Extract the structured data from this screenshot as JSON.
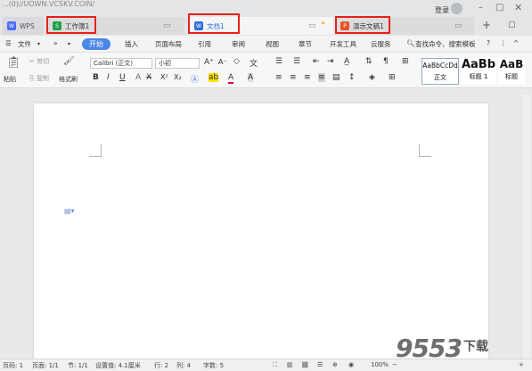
{
  "watermark_top": "...(0)//UOWN.VCSKV.COIN/",
  "titlebar": {
    "login": "登录",
    "tabs": [
      {
        "label": "WPS"
      },
      {
        "label": "工作簿1"
      },
      {
        "label": "文档1"
      },
      {
        "label": "演示文稿1"
      }
    ],
    "new_tab": "+",
    "menu_icon": "☰"
  },
  "menubar": {
    "file": "文件",
    "more": "»",
    "items": [
      "开始",
      "插入",
      "页面布局",
      "引用",
      "审阅",
      "视图",
      "章节",
      "开发工具",
      "云服务"
    ],
    "search_placeholder": "查找命令、搜索模板",
    "help": "?"
  },
  "ribbon": {
    "paste": "粘贴",
    "cut": "剪切",
    "copy": "复制",
    "format_painter": "格式刷",
    "font_name": "Calibri (正文)",
    "font_size": "小初",
    "styles": [
      {
        "preview": "AaBbCcDd",
        "label": "正文"
      },
      {
        "preview": "AaBb",
        "label": "标题 1"
      },
      {
        "preview": "AaB",
        "label": "标题"
      }
    ]
  },
  "statusbar": {
    "page_num": "页码: 1",
    "pages": "页面: 1/1",
    "section": "节: 1/1",
    "position": "设置值: 4.1厘米",
    "line": "行: 2",
    "col": "列: 4",
    "word_count": "字数: 5",
    "zoom": "100%"
  },
  "watermark": {
    "digits": "9553",
    "suffix": "下载"
  },
  "colors": {
    "accent": "#4a86e8",
    "highlight_box": "#e6211a"
  }
}
